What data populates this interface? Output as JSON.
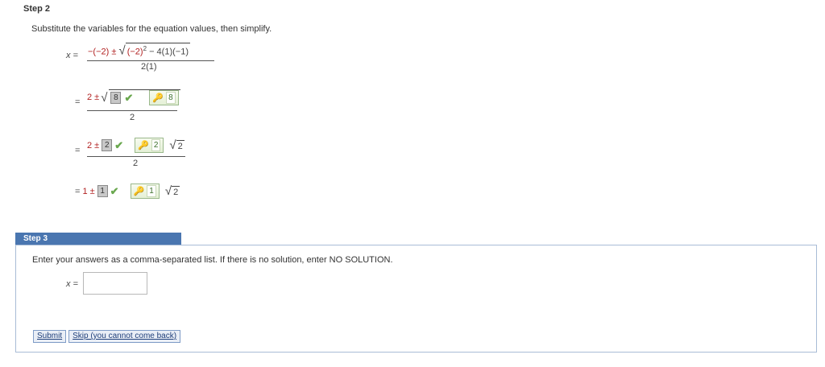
{
  "step2": {
    "title": "Step 2",
    "instruction": "Substitute the variables for the equation values, then simplify.",
    "line1": {
      "lhs": "x =",
      "numerator_prefix": "−(−2) ±",
      "radicand_a": "(−2)",
      "radicand_exp": "2",
      "radicand_b": "− 4(1)(−1)",
      "denominator": "2(1)"
    },
    "line2": {
      "eq": "=",
      "prefix": "2 ±",
      "gray_value": "8",
      "key_value": "8",
      "denominator": "2"
    },
    "line3": {
      "eq": "=",
      "prefix": "2 ±",
      "gray_value": "2",
      "key_value": "2",
      "radicand": "2",
      "denominator": "2"
    },
    "line4": {
      "eq": "=",
      "prefix": "1 ±",
      "gray_value": "1",
      "key_value": "1",
      "radicand": "2"
    }
  },
  "step3": {
    "title": "Step 3",
    "instruction": "Enter your answers as a comma-separated list. If there is no solution, enter NO SOLUTION.",
    "input_label": "x =",
    "input_value": "",
    "submit_label": "Submit",
    "skip_label": "Skip (you cannot come back)"
  },
  "colors": {
    "step3_tab": "#4a76b0",
    "check": "#6aa84f",
    "red_value": "#b22222"
  }
}
